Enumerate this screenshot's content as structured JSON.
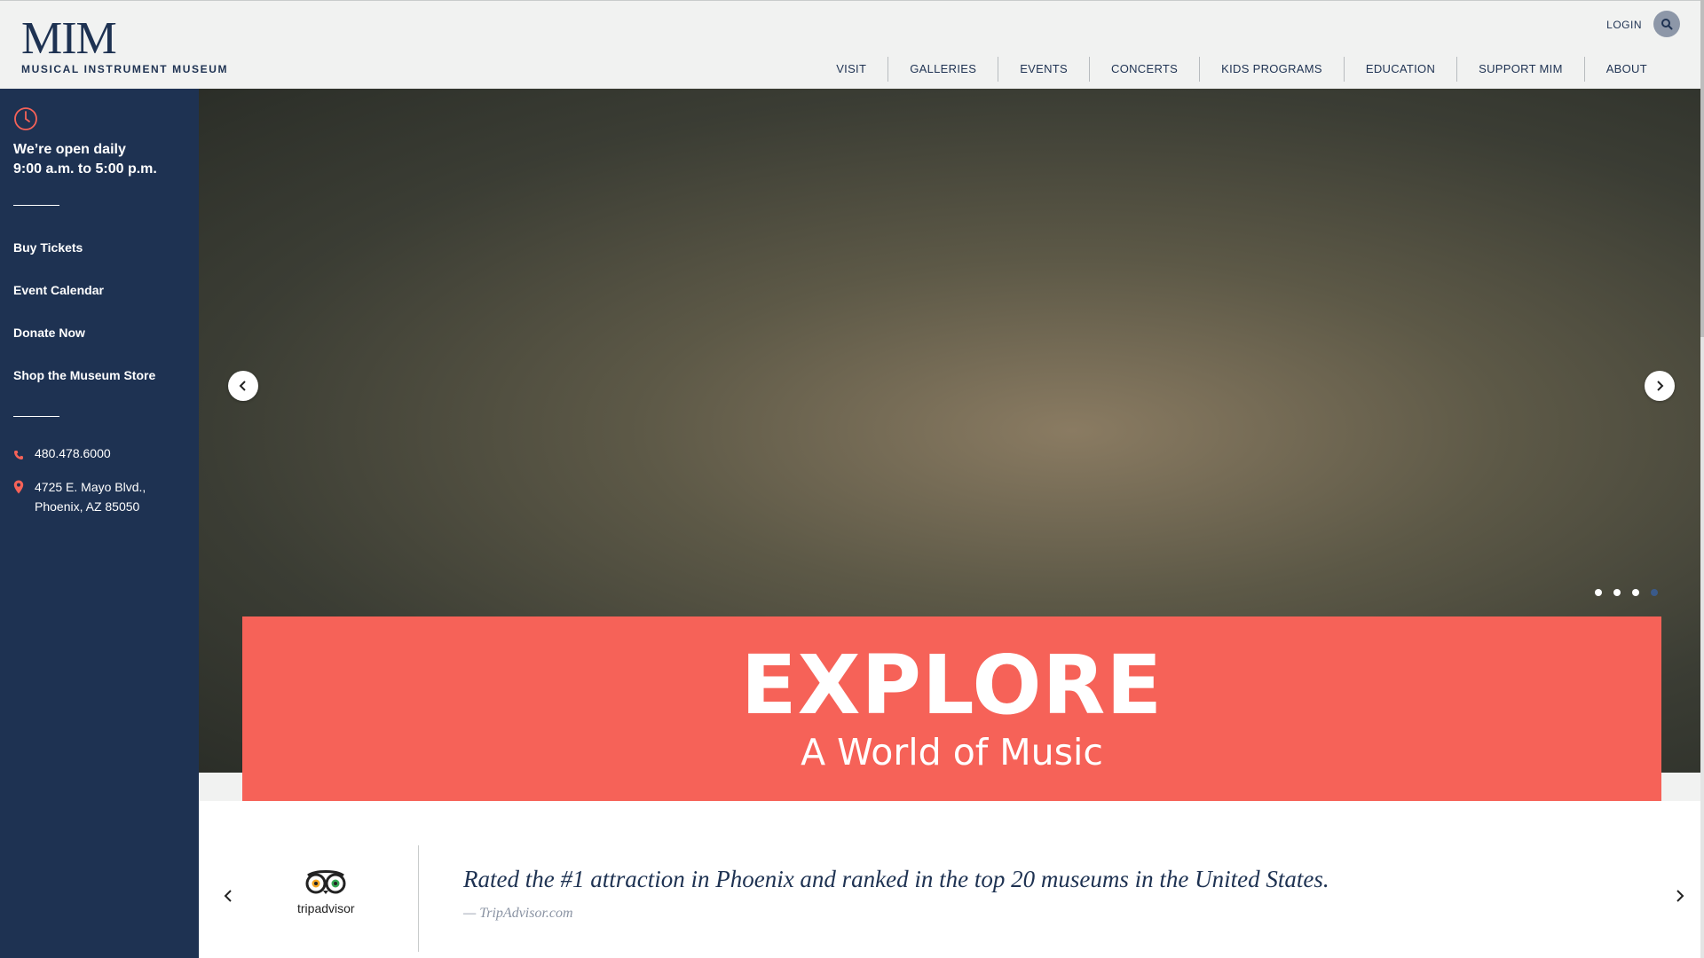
{
  "header": {
    "logo_mark": "MIM",
    "logo_sub": "MUSICAL INSTRUMENT MUSEUM",
    "login": "LOGIN",
    "nav": [
      "VISIT",
      "GALLERIES",
      "EVENTS",
      "CONCERTS",
      "KIDS PROGRAMS",
      "EDUCATION",
      "SUPPORT MIM",
      "ABOUT"
    ]
  },
  "sidebar": {
    "hours_line1": "We’re open daily",
    "hours_line2": "9:00 a.m. to 5:00 p.m.",
    "links": [
      "Buy Tickets",
      "Event Calendar",
      "Donate Now",
      "Shop the Museum Store"
    ],
    "phone": "480.478.6000",
    "address_line1": "4725 E. Mayo Blvd.,",
    "address_line2": "Phoenix, AZ 85050"
  },
  "hero": {
    "title": "EXPLORE",
    "subtitle": "A World of Music",
    "slide_count": 4,
    "active_slide": 4
  },
  "testimonial": {
    "brand": "tripadvisor",
    "quote": "Rated the #1 attraction in Phoenix and ranked in the top 20 museums in the United States.",
    "source": "— TripAdvisor.com"
  },
  "colors": {
    "navy": "#1e3252",
    "coral": "#f66258",
    "header_bg": "#f1f2f1"
  },
  "icons": [
    "clock-icon",
    "search-icon",
    "phone-icon",
    "location-pin-icon",
    "chevron-left-icon",
    "chevron-right-icon",
    "tripadvisor-owl-icon"
  ]
}
